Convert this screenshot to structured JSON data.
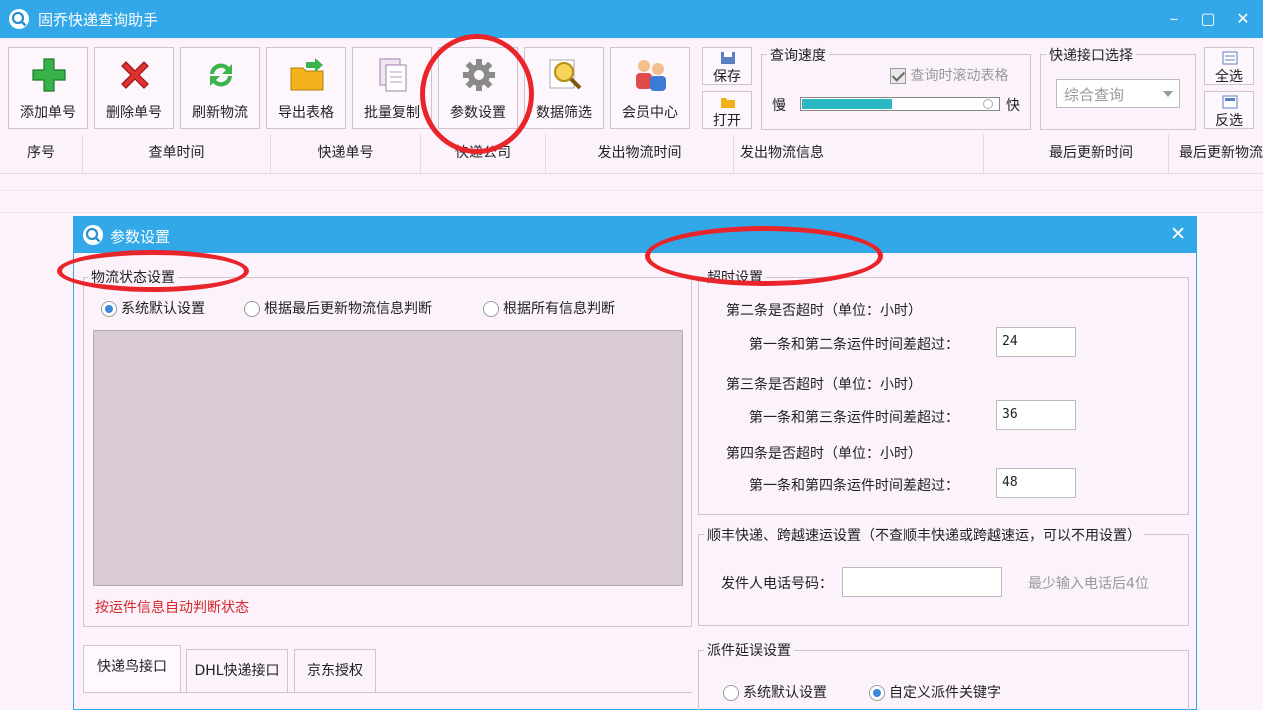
{
  "window": {
    "title": "固乔快递查询助手",
    "controls": [
      "–",
      "▢",
      "✕"
    ]
  },
  "toolbar": {
    "buttons": [
      {
        "label": "添加单号",
        "icon": "plus-icon"
      },
      {
        "label": "删除单号",
        "icon": "delete-x-icon"
      },
      {
        "label": "刷新物流",
        "icon": "refresh-icon"
      },
      {
        "label": "导出表格",
        "icon": "export-folder-icon"
      },
      {
        "label": "批量复制",
        "icon": "copy-icon"
      },
      {
        "label": "参数设置",
        "icon": "gear-icon"
      },
      {
        "label": "数据筛选",
        "icon": "filter-magnifier-icon"
      },
      {
        "label": "会员中心",
        "icon": "members-icon"
      }
    ],
    "save_label": "保存",
    "open_label": "打开",
    "speed": {
      "title": "查询速度",
      "scroll_label": "查询时滚动表格",
      "slow": "慢",
      "fast": "快",
      "value": 0.46
    },
    "api": {
      "title": "快递接口选择",
      "selected": "综合查询"
    },
    "select_all": "全选",
    "invert": "反选"
  },
  "table": {
    "columns": [
      "序号",
      "查单时间",
      "快递单号",
      "快递公司",
      "发出物流时间",
      "发出物流信息",
      "最后更新时间",
      "最后更新物流"
    ]
  },
  "dialog": {
    "title": "参数设置",
    "close": "✕",
    "logistics": {
      "title": "物流状态设置",
      "options": [
        "系统默认设置",
        "根据最后更新物流信息判断",
        "根据所有信息判断"
      ],
      "selected": 0,
      "note": "按运件信息自动判断状态"
    },
    "timeout": {
      "title": "超时设置",
      "rows": [
        {
          "heading": "第二条是否超时（单位：小时）",
          "label": "第一条和第二条运件时间差超过：",
          "value": "24"
        },
        {
          "heading": "第三条是否超时（单位：小时）",
          "label": "第一条和第三条运件时间差超过：",
          "value": "36"
        },
        {
          "heading": "第四条是否超时（单位：小时）",
          "label": "第一条和第四条运件时间差超过：",
          "value": "48"
        }
      ]
    },
    "sf": {
      "title": "顺丰快递、跨越速运设置（不查顺丰快递或跨越速运，可以不用设置）",
      "phone_label": "发件人电话号码：",
      "phone_value": "",
      "hint": "最少输入电话后4位"
    },
    "tabs": [
      "快递鸟接口",
      "DHL快递接口",
      "京东授权"
    ],
    "delay": {
      "title": "派件延误设置",
      "options": [
        "系统默认设置",
        "自定义派件关键字"
      ],
      "selected": 1
    }
  },
  "colors": {
    "titlebar": "#33a8e9",
    "accent_red": "#e8252a",
    "slider": "#2ab7c6"
  }
}
